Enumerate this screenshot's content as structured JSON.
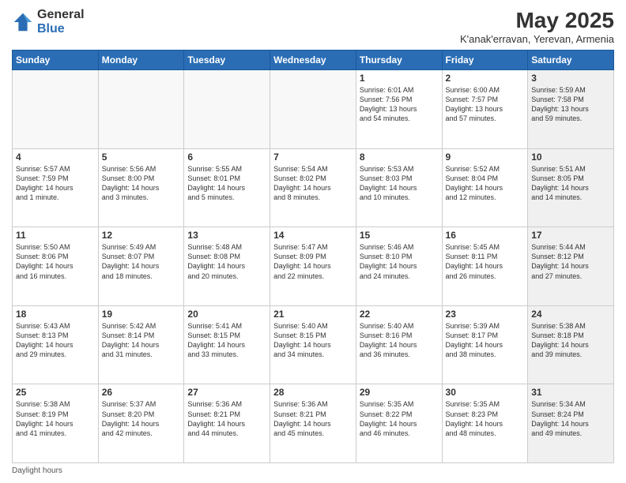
{
  "header": {
    "logo_general": "General",
    "logo_blue": "Blue",
    "title": "May 2025",
    "subtitle": "K'anak'erravan, Yerevan, Armenia"
  },
  "days_of_week": [
    "Sunday",
    "Monday",
    "Tuesday",
    "Wednesday",
    "Thursday",
    "Friday",
    "Saturday"
  ],
  "weeks": [
    [
      {
        "day": "",
        "info": "",
        "empty": true
      },
      {
        "day": "",
        "info": "",
        "empty": true
      },
      {
        "day": "",
        "info": "",
        "empty": true
      },
      {
        "day": "",
        "info": "",
        "empty": true
      },
      {
        "day": "1",
        "info": "Sunrise: 6:01 AM\nSunset: 7:56 PM\nDaylight: 13 hours\nand 54 minutes."
      },
      {
        "day": "2",
        "info": "Sunrise: 6:00 AM\nSunset: 7:57 PM\nDaylight: 13 hours\nand 57 minutes."
      },
      {
        "day": "3",
        "info": "Sunrise: 5:59 AM\nSunset: 7:58 PM\nDaylight: 13 hours\nand 59 minutes.",
        "shaded": true
      }
    ],
    [
      {
        "day": "4",
        "info": "Sunrise: 5:57 AM\nSunset: 7:59 PM\nDaylight: 14 hours\nand 1 minute."
      },
      {
        "day": "5",
        "info": "Sunrise: 5:56 AM\nSunset: 8:00 PM\nDaylight: 14 hours\nand 3 minutes."
      },
      {
        "day": "6",
        "info": "Sunrise: 5:55 AM\nSunset: 8:01 PM\nDaylight: 14 hours\nand 5 minutes."
      },
      {
        "day": "7",
        "info": "Sunrise: 5:54 AM\nSunset: 8:02 PM\nDaylight: 14 hours\nand 8 minutes."
      },
      {
        "day": "8",
        "info": "Sunrise: 5:53 AM\nSunset: 8:03 PM\nDaylight: 14 hours\nand 10 minutes."
      },
      {
        "day": "9",
        "info": "Sunrise: 5:52 AM\nSunset: 8:04 PM\nDaylight: 14 hours\nand 12 minutes."
      },
      {
        "day": "10",
        "info": "Sunrise: 5:51 AM\nSunset: 8:05 PM\nDaylight: 14 hours\nand 14 minutes.",
        "shaded": true
      }
    ],
    [
      {
        "day": "11",
        "info": "Sunrise: 5:50 AM\nSunset: 8:06 PM\nDaylight: 14 hours\nand 16 minutes."
      },
      {
        "day": "12",
        "info": "Sunrise: 5:49 AM\nSunset: 8:07 PM\nDaylight: 14 hours\nand 18 minutes."
      },
      {
        "day": "13",
        "info": "Sunrise: 5:48 AM\nSunset: 8:08 PM\nDaylight: 14 hours\nand 20 minutes."
      },
      {
        "day": "14",
        "info": "Sunrise: 5:47 AM\nSunset: 8:09 PM\nDaylight: 14 hours\nand 22 minutes."
      },
      {
        "day": "15",
        "info": "Sunrise: 5:46 AM\nSunset: 8:10 PM\nDaylight: 14 hours\nand 24 minutes."
      },
      {
        "day": "16",
        "info": "Sunrise: 5:45 AM\nSunset: 8:11 PM\nDaylight: 14 hours\nand 26 minutes."
      },
      {
        "day": "17",
        "info": "Sunrise: 5:44 AM\nSunset: 8:12 PM\nDaylight: 14 hours\nand 27 minutes.",
        "shaded": true
      }
    ],
    [
      {
        "day": "18",
        "info": "Sunrise: 5:43 AM\nSunset: 8:13 PM\nDaylight: 14 hours\nand 29 minutes."
      },
      {
        "day": "19",
        "info": "Sunrise: 5:42 AM\nSunset: 8:14 PM\nDaylight: 14 hours\nand 31 minutes."
      },
      {
        "day": "20",
        "info": "Sunrise: 5:41 AM\nSunset: 8:15 PM\nDaylight: 14 hours\nand 33 minutes."
      },
      {
        "day": "21",
        "info": "Sunrise: 5:40 AM\nSunset: 8:15 PM\nDaylight: 14 hours\nand 34 minutes."
      },
      {
        "day": "22",
        "info": "Sunrise: 5:40 AM\nSunset: 8:16 PM\nDaylight: 14 hours\nand 36 minutes."
      },
      {
        "day": "23",
        "info": "Sunrise: 5:39 AM\nSunset: 8:17 PM\nDaylight: 14 hours\nand 38 minutes."
      },
      {
        "day": "24",
        "info": "Sunrise: 5:38 AM\nSunset: 8:18 PM\nDaylight: 14 hours\nand 39 minutes.",
        "shaded": true
      }
    ],
    [
      {
        "day": "25",
        "info": "Sunrise: 5:38 AM\nSunset: 8:19 PM\nDaylight: 14 hours\nand 41 minutes."
      },
      {
        "day": "26",
        "info": "Sunrise: 5:37 AM\nSunset: 8:20 PM\nDaylight: 14 hours\nand 42 minutes."
      },
      {
        "day": "27",
        "info": "Sunrise: 5:36 AM\nSunset: 8:21 PM\nDaylight: 14 hours\nand 44 minutes."
      },
      {
        "day": "28",
        "info": "Sunrise: 5:36 AM\nSunset: 8:21 PM\nDaylight: 14 hours\nand 45 minutes."
      },
      {
        "day": "29",
        "info": "Sunrise: 5:35 AM\nSunset: 8:22 PM\nDaylight: 14 hours\nand 46 minutes."
      },
      {
        "day": "30",
        "info": "Sunrise: 5:35 AM\nSunset: 8:23 PM\nDaylight: 14 hours\nand 48 minutes."
      },
      {
        "day": "31",
        "info": "Sunrise: 5:34 AM\nSunset: 8:24 PM\nDaylight: 14 hours\nand 49 minutes.",
        "shaded": true
      }
    ]
  ],
  "footer": "Daylight hours"
}
